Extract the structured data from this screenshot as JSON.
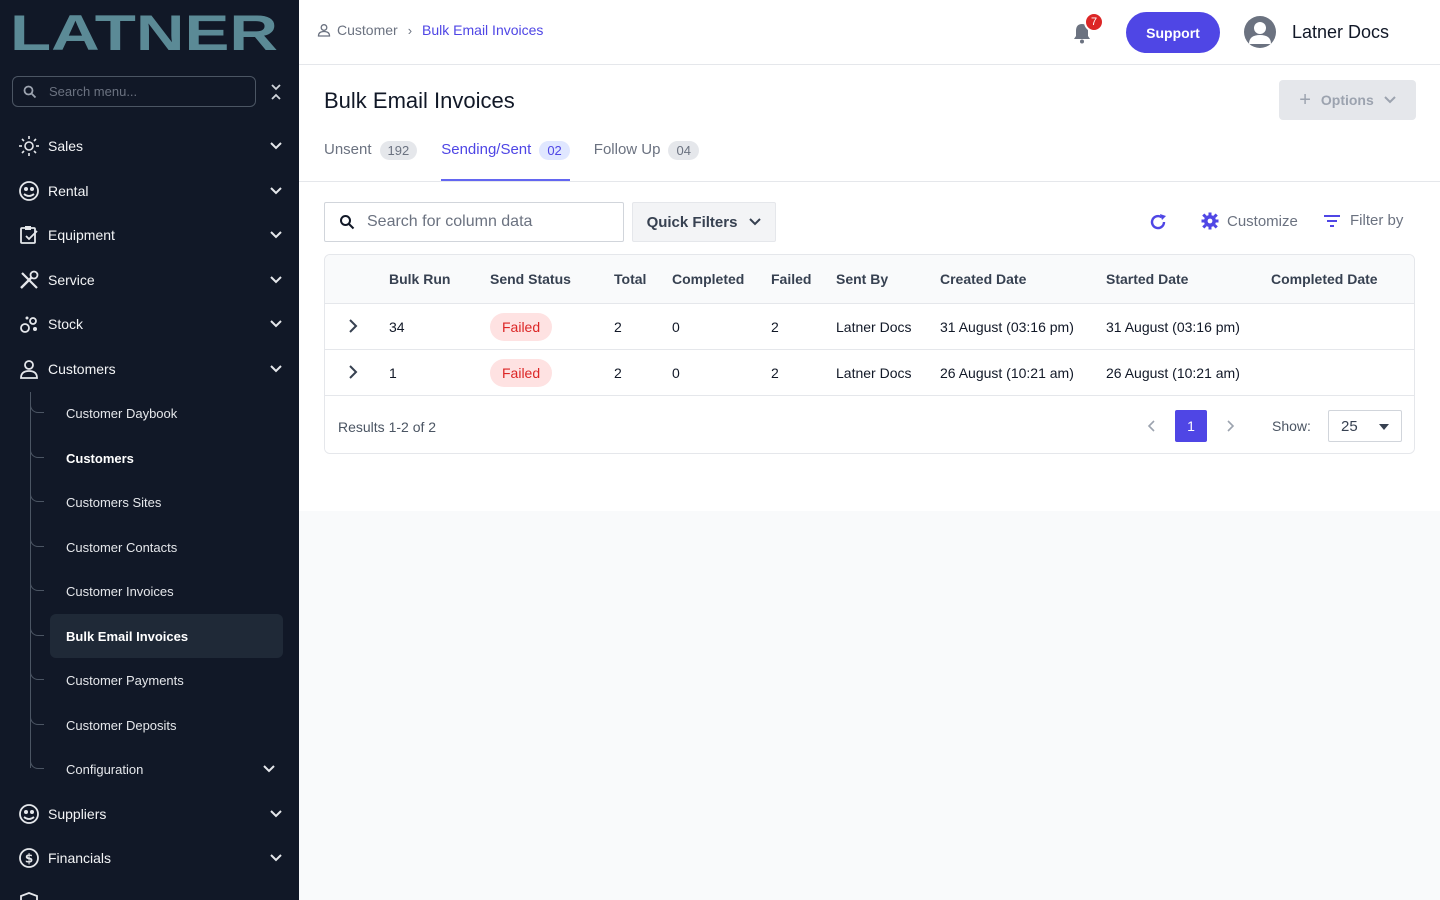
{
  "brand": {
    "logo_text": "LATNER"
  },
  "sidebar": {
    "search_placeholder": "Search menu...",
    "items": [
      {
        "label": "Sales",
        "icon": "sales-icon"
      },
      {
        "label": "Rental",
        "icon": "rental-icon"
      },
      {
        "label": "Equipment",
        "icon": "equipment-icon"
      },
      {
        "label": "Service",
        "icon": "service-icon"
      },
      {
        "label": "Stock",
        "icon": "stock-icon"
      },
      {
        "label": "Customers",
        "icon": "customers-icon"
      },
      {
        "label": "Suppliers",
        "icon": "suppliers-icon"
      },
      {
        "label": "Financials",
        "icon": "financials-icon"
      }
    ],
    "customers_sub": [
      {
        "label": "Customer Daybook"
      },
      {
        "label": "Customers"
      },
      {
        "label": "Customers Sites"
      },
      {
        "label": "Customer Contacts"
      },
      {
        "label": "Customer Invoices"
      },
      {
        "label": "Bulk Email Invoices"
      },
      {
        "label": "Customer Payments"
      },
      {
        "label": "Customer Deposits"
      },
      {
        "label": "Configuration"
      }
    ]
  },
  "topbar": {
    "breadcrumb": [
      "Customer",
      "Bulk Email Invoices"
    ],
    "notification_count": "7",
    "support_label": "Support",
    "user_name": "Latner Docs"
  },
  "page": {
    "title": "Bulk Email Invoices",
    "options_label": "Options",
    "tabs": [
      {
        "label": "Unsent",
        "count": "192"
      },
      {
        "label": "Sending/Sent",
        "count": "02"
      },
      {
        "label": "Follow Up",
        "count": "04"
      }
    ]
  },
  "toolbar": {
    "search_placeholder": "Search for column data",
    "quick_filters_label": "Quick Filters",
    "customize_label": "Customize",
    "filter_label": "Filter by"
  },
  "table": {
    "columns": [
      "Bulk Run",
      "Send Status",
      "Total",
      "Completed",
      "Failed",
      "Sent By",
      "Created Date",
      "Started Date",
      "Completed Date"
    ],
    "rows": [
      {
        "bulk_run": "34",
        "status": "Failed",
        "total": "2",
        "completed": "0",
        "failed": "2",
        "sent_by": "Latner Docs",
        "created": "31 August (03:16 pm)",
        "started": "31 August (03:16 pm)",
        "completed_date": ""
      },
      {
        "bulk_run": "1",
        "status": "Failed",
        "total": "2",
        "completed": "0",
        "failed": "2",
        "sent_by": "Latner Docs",
        "created": "26 August (10:21 am)",
        "started": "26 August (10:21 am)",
        "completed_date": ""
      }
    ],
    "results_text": "Results 1-2 of 2",
    "current_page": "1",
    "show_label": "Show:",
    "page_size": "25"
  },
  "colors": {
    "sidebar_bg": "#111827",
    "accent": "#4f46e5",
    "failed_bg": "#fee2e2",
    "failed_text": "#dc2626",
    "logo": "#5b8a96"
  }
}
